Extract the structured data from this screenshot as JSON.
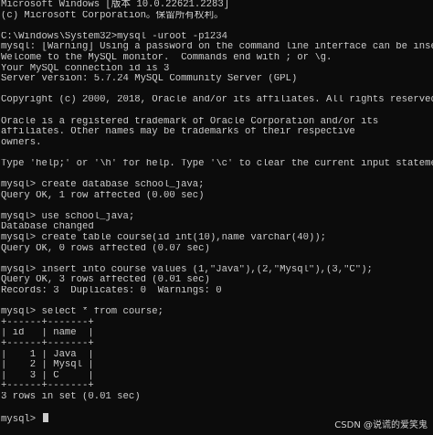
{
  "console": {
    "lines": [
      "Microsoft Windows [版本 10.0.22621.2283]",
      "(c) Microsoft Corporation。保留所有权利。",
      "",
      "C:\\Windows\\System32>mysql -uroot -p1234",
      "mysql: [Warning] Using a password on the command line interface can be insecure.",
      "Welcome to the MySQL monitor.  Commands end with ; or \\g.",
      "Your MySQL connection id is 3",
      "Server version: 5.7.24 MySQL Community Server (GPL)",
      "",
      "Copyright (c) 2000, 2018, Oracle and/or its affiliates. All rights reserved.",
      "",
      "Oracle is a registered trademark of Oracle Corporation and/or its",
      "affiliates. Other names may be trademarks of their respective",
      "owners.",
      "",
      "Type 'help;' or '\\h' for help. Type '\\c' to clear the current input statement.",
      "",
      "mysql> create database school_java;",
      "Query OK, 1 row affected (0.00 sec)",
      "",
      "mysql> use school_java;",
      "Database changed",
      "mysql> create table course(id int(10),name varchar(40));",
      "Query OK, 0 rows affected (0.07 sec)",
      "",
      "mysql> insert into course values (1,\"Java\"),(2,\"Mysql\"),(3,\"C\");",
      "Query OK, 3 rows affected (0.01 sec)",
      "Records: 3  Duplicates: 0  Warnings: 0",
      "",
      "mysql> select * from course;",
      "+------+-------+",
      "| id   | name  |",
      "+------+-------+",
      "|    1 | Java  |",
      "|    2 | Mysql |",
      "|    3 | C     |",
      "+------+-------+",
      "3 rows in set (0.01 sec)",
      "",
      "mysql> "
    ]
  },
  "watermark": "CSDN @说谎的爱笑鬼"
}
